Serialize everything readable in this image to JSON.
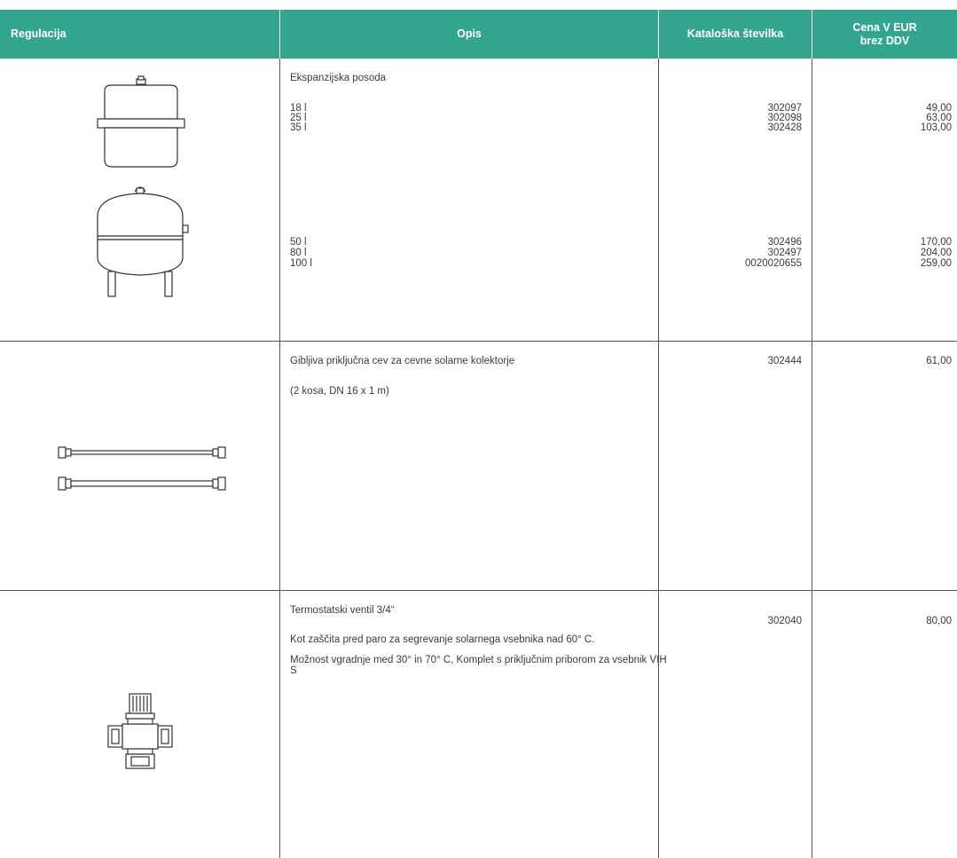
{
  "header": {
    "col1": "Regulacija",
    "col2": "Opis",
    "col3": "Kataloška številka",
    "col4_line1": "Cena V EUR",
    "col4_line2": "brez DDV"
  },
  "rows": [
    {
      "title": "Ekspanzijska posoda",
      "groupA": {
        "sizes": [
          "18 l",
          "25 l",
          "35 l"
        ],
        "catalog": [
          "302097",
          "302098",
          "302428"
        ],
        "prices": [
          "49,00",
          "63,00",
          "103,00"
        ]
      },
      "groupB": {
        "sizes": [
          "50 l",
          "80 l",
          "100 l"
        ],
        "catalog": [
          "302496",
          "302497",
          "0020020655"
        ],
        "prices": [
          "170,00",
          "204,00",
          "259,00"
        ]
      },
      "images": [
        "expansion-vessel-small",
        "expansion-vessel-large"
      ]
    },
    {
      "title": "Gibljiva priključna cev za cevne solarne kolektorje",
      "note": "(2 kosa, DN 16 x 1 m)",
      "catalog": "302444",
      "price": "61,00",
      "image": "flexible-hose-pair"
    },
    {
      "title": "Termostatski ventil 3/4“",
      "desc1": "Kot zaščita pred paro za segrevanje solarnega vsebnika nad 60° C.",
      "desc2": "Možnost vgradnje med 30° in 70° C, Komplet s priključnim priborom za vsebnik VIH S",
      "catalog": "302040",
      "price": "80,00",
      "image": "thermostatic-valve"
    }
  ],
  "colors": {
    "header_bg": "#34a58f",
    "header_text": "#ffffff",
    "lines": "#555555"
  }
}
